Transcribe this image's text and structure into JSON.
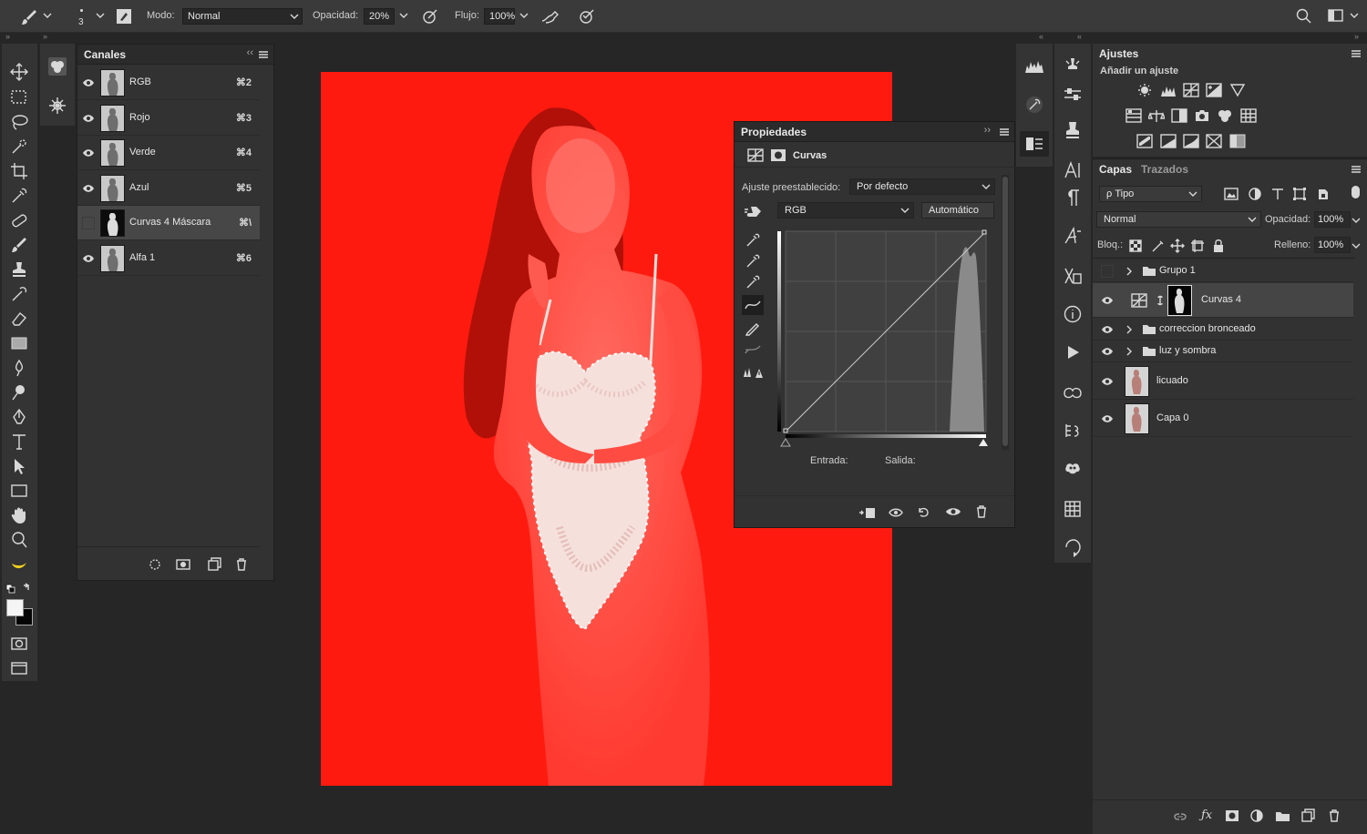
{
  "options_bar": {
    "brush_size": "3",
    "mode_label": "Modo:",
    "mode_value": "Normal",
    "opacity_label": "Opacidad:",
    "opacity_value": "20%",
    "flow_label": "Flujo:",
    "flow_value": "100%"
  },
  "channels": {
    "title": "Canales",
    "rows": [
      {
        "name": "RGB",
        "shortcut": "⌘2",
        "visible": true
      },
      {
        "name": "Rojo",
        "shortcut": "⌘3",
        "visible": true
      },
      {
        "name": "Verde",
        "shortcut": "⌘4",
        "visible": true
      },
      {
        "name": "Azul",
        "shortcut": "⌘5",
        "visible": true
      },
      {
        "name": "Curvas 4 Máscara",
        "shortcut": "⌘\\",
        "visible": false,
        "selected": true
      },
      {
        "name": "Alfa 1",
        "shortcut": "⌘6",
        "visible": true
      }
    ]
  },
  "properties": {
    "title": "Propiedades",
    "type_label": "Curvas",
    "preset_label": "Ajuste preestablecido:",
    "preset_value": "Por defecto",
    "channel_value": "RGB",
    "auto_button": "Automático",
    "input_label": "Entrada:",
    "output_label": "Salida:"
  },
  "adjustments": {
    "title": "Ajustes",
    "subtitle": "Añadir un ajuste"
  },
  "layers": {
    "tabs": [
      "Capas",
      "Trazados"
    ],
    "filter_value": "ρ Tipo",
    "blend_value": "Normal",
    "opacity_label": "Opacidad:",
    "opacity_value": "100%",
    "lock_label": "Bloq.:",
    "fill_label": "Relleno:",
    "fill_value": "100%",
    "rows": [
      {
        "name": "Grupo 1",
        "type": "group",
        "visible": false
      },
      {
        "name": "Curvas 4",
        "type": "adjustment",
        "visible": true,
        "selected": true
      },
      {
        "name": "correccion bronceado",
        "type": "group",
        "visible": true
      },
      {
        "name": "luz y sombra",
        "type": "group",
        "visible": true
      },
      {
        "name": "licuado",
        "type": "pixel",
        "visible": true
      },
      {
        "name": "Capa 0",
        "type": "pixel",
        "visible": true
      }
    ]
  },
  "colors": {
    "canvas_red": "#ff1a0f",
    "panel_bg": "#323232",
    "app_bg": "#262626"
  }
}
